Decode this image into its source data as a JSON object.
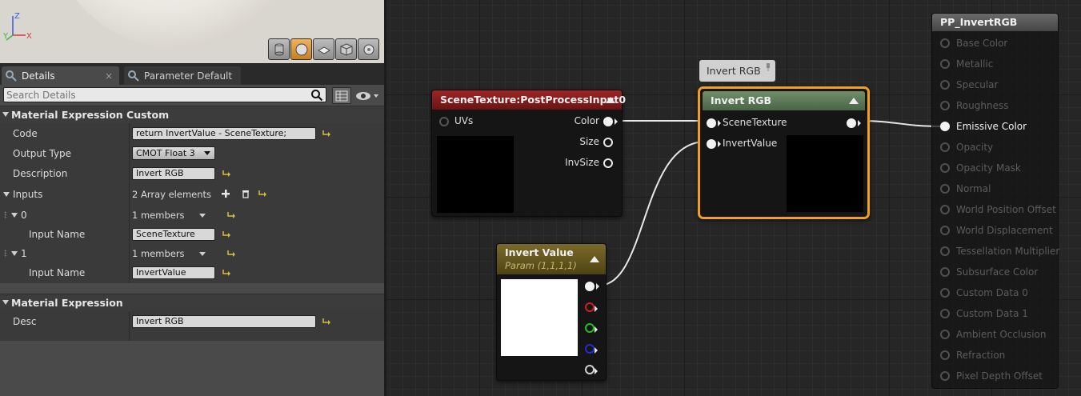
{
  "viewport": {
    "axis": {
      "x": "X",
      "y": "Y",
      "z": "Z"
    },
    "buttons": [
      "cylinder-icon",
      "sphere-icon",
      "plane-icon",
      "cube-icon",
      "mesh-icon"
    ]
  },
  "tabs": [
    {
      "label": "Details",
      "active": true
    },
    {
      "label": "Parameter Default"
    }
  ],
  "search": {
    "placeholder": "Search Details"
  },
  "sections": {
    "custom": {
      "title": "Material Expression Custom"
    },
    "expr": {
      "title": "Material Expression"
    }
  },
  "props": {
    "code_label": "Code",
    "code_value": "return InvertValue - SceneTexture;",
    "output_label": "Output Type",
    "output_value": "CMOT Float 3",
    "desc_label": "Description",
    "desc_value": "Invert RGB",
    "inputs_label": "Inputs",
    "inputs_value": "2 Array elements",
    "idx0": "0",
    "members0": "1 members",
    "input_name_label": "Input Name",
    "input_name0": "SceneTexture",
    "idx1": "1",
    "members1": "1 members",
    "input_name1": "InvertValue",
    "desc2_label": "Desc",
    "desc2_value": "Invert RGB"
  },
  "nodes": {
    "scene": {
      "title": "SceneTexture:PostProcessInput0",
      "in_uvs": "UVs",
      "out_color": "Color",
      "out_size": "Size",
      "out_invsize": "InvSize"
    },
    "invert": {
      "title": "Invert RGB",
      "in_scene": "SceneTexture",
      "in_invert": "InvertValue"
    },
    "param": {
      "title": "Invert Value",
      "subtitle": "Param (1,1,1,1)"
    },
    "comment": "Invert RGB",
    "result": {
      "title": "PP_InvertRGB",
      "items": [
        "Base Color",
        "Metallic",
        "Specular",
        "Roughness",
        "Emissive Color",
        "Opacity",
        "Opacity Mask",
        "Normal",
        "World Position Offset",
        "World Displacement",
        "Tessellation Multiplier",
        "Subsurface Color",
        "Custom Data 0",
        "Custom Data 1",
        "Ambient Occlusion",
        "Refraction",
        "Pixel Depth Offset"
      ],
      "active_item": "Emissive Color"
    }
  },
  "colors": {
    "scene_title": "#8b1e1e",
    "invert_title": "#5f7d5a",
    "param_title": "#6b5a1e",
    "selection": "#f0a020",
    "reset_arrow": "#d8c040"
  }
}
